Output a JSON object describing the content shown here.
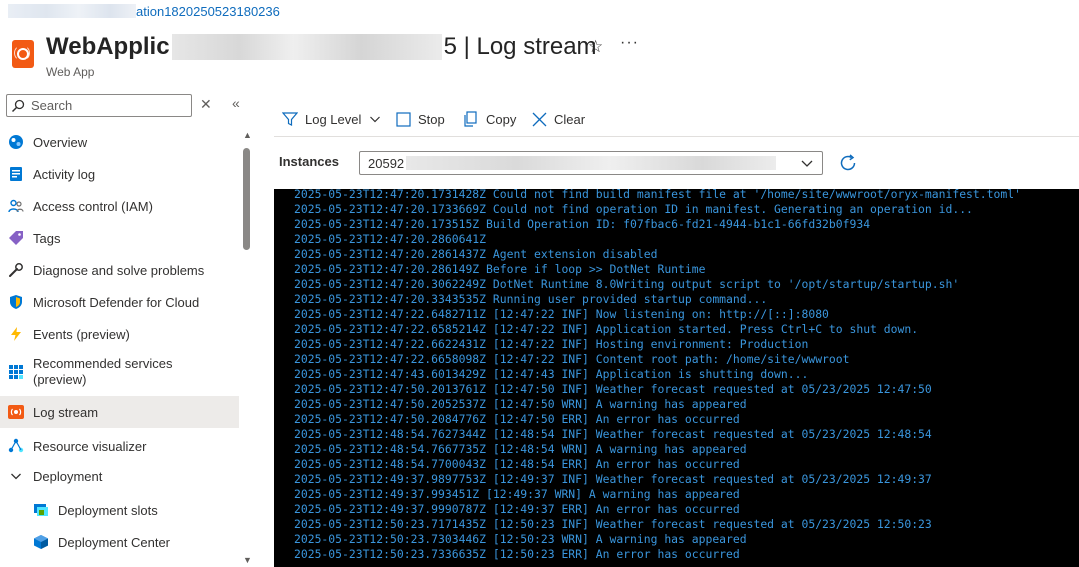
{
  "breadcrumb": {
    "visible_text": "ation1820250523180236"
  },
  "header": {
    "title_prefix": "WebApplic",
    "title_suffix": "5 | Log stream",
    "subtitle": "Web App",
    "favorite_icon": "star-icon",
    "more_icon": "ellipsis-icon"
  },
  "search": {
    "placeholder": "Search"
  },
  "sidebar": {
    "items": [
      {
        "label": "Overview",
        "icon": "overview-icon"
      },
      {
        "label": "Activity log",
        "icon": "activity-log-icon"
      },
      {
        "label": "Access control (IAM)",
        "icon": "people-icon"
      },
      {
        "label": "Tags",
        "icon": "tag-icon"
      },
      {
        "label": "Diagnose and solve problems",
        "icon": "wrench-icon"
      },
      {
        "label": "Microsoft Defender for Cloud",
        "icon": "shield-icon"
      },
      {
        "label": "Events (preview)",
        "icon": "lightning-icon"
      },
      {
        "label": "Recommended services",
        "label2": "(preview)",
        "icon": "grid-icon"
      },
      {
        "label": "Log stream",
        "icon": "log-stream-icon",
        "active": true
      },
      {
        "label": "Resource visualizer",
        "icon": "visualizer-icon"
      },
      {
        "label": "Deployment",
        "icon": "chevron-down-icon"
      },
      {
        "label": "Deployment slots",
        "icon": "slots-icon"
      },
      {
        "label": "Deployment Center",
        "icon": "cube-icon"
      }
    ]
  },
  "toolbar": {
    "log_level": "Log Level",
    "stop": "Stop",
    "copy": "Copy",
    "clear": "Clear"
  },
  "instances": {
    "label": "Instances",
    "selected_prefix": "20592"
  },
  "colors": {
    "accent": "#0f6cbd",
    "console_bg": "#000000",
    "console_text": "#3a96dd",
    "active_nav": "#edebe9"
  },
  "logs": [
    "2025-05-23T12:47:20.1731428Z Could not find build manifest file at '/home/site/wwwroot/oryx-manifest.toml'",
    "2025-05-23T12:47:20.1733669Z Could not find operation ID in manifest. Generating an operation id...",
    "2025-05-23T12:47:20.173515Z Build Operation ID: f07fbac6-fd21-4944-b1c1-66fd32b0f934",
    "2025-05-23T12:47:20.2860641Z",
    "2025-05-23T12:47:20.2861437Z Agent extension disabled",
    "2025-05-23T12:47:20.286149Z Before if loop >> DotNet Runtime",
    "2025-05-23T12:47:20.3062249Z DotNet Runtime 8.0Writing output script to '/opt/startup/startup.sh'",
    "2025-05-23T12:47:20.3343535Z Running user provided startup command...",
    "2025-05-23T12:47:22.6482711Z [12:47:22 INF] Now listening on: http://[::]:8080",
    "2025-05-23T12:47:22.6585214Z [12:47:22 INF] Application started. Press Ctrl+C to shut down.",
    "2025-05-23T12:47:22.6622431Z [12:47:22 INF] Hosting environment: Production",
    "2025-05-23T12:47:22.6658098Z [12:47:22 INF] Content root path: /home/site/wwwroot",
    "2025-05-23T12:47:43.6013429Z [12:47:43 INF] Application is shutting down...",
    "2025-05-23T12:47:50.2013761Z [12:47:50 INF] Weather forecast requested at 05/23/2025 12:47:50",
    "2025-05-23T12:47:50.2052537Z [12:47:50 WRN] A warning has appeared",
    "2025-05-23T12:47:50.2084776Z [12:47:50 ERR] An error has occurred",
    "2025-05-23T12:48:54.7627344Z [12:48:54 INF] Weather forecast requested at 05/23/2025 12:48:54",
    "2025-05-23T12:48:54.7667735Z [12:48:54 WRN] A warning has appeared",
    "2025-05-23T12:48:54.7700043Z [12:48:54 ERR] An error has occurred",
    "2025-05-23T12:49:37.9897753Z [12:49:37 INF] Weather forecast requested at 05/23/2025 12:49:37",
    "2025-05-23T12:49:37.993451Z [12:49:37 WRN] A warning has appeared",
    "2025-05-23T12:49:37.9990787Z [12:49:37 ERR] An error has occurred",
    "2025-05-23T12:50:23.7171435Z [12:50:23 INF] Weather forecast requested at 05/23/2025 12:50:23",
    "2025-05-23T12:50:23.7303446Z [12:50:23 WRN] A warning has appeared",
    "2025-05-23T12:50:23.7336635Z [12:50:23 ERR] An error has occurred"
  ]
}
